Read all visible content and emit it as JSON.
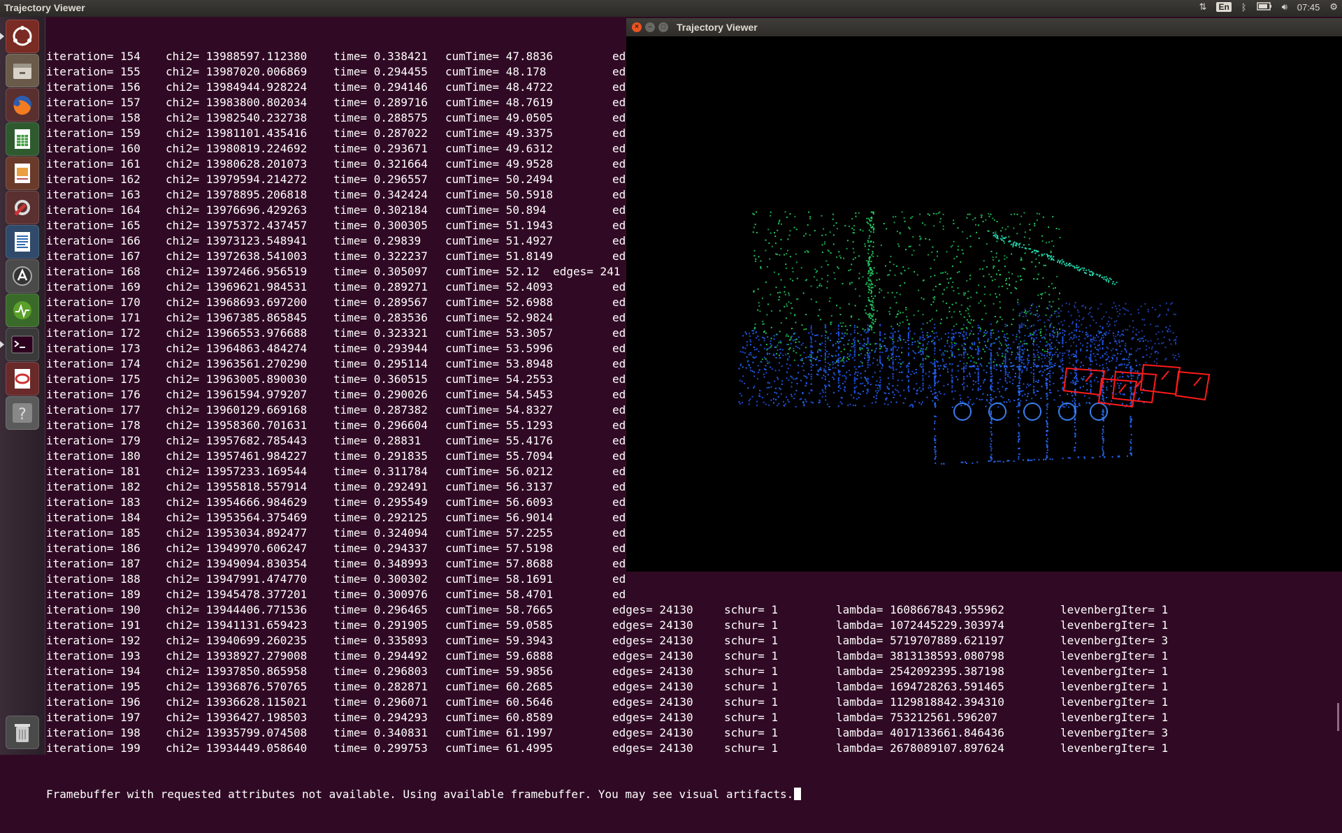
{
  "top_panel": {
    "title": "Trajectory Viewer",
    "keyboard": "En",
    "time": "07:45",
    "icons": [
      "network-arrows-icon",
      "keyboard-layout-icon",
      "bluetooth-icon",
      "battery-icon",
      "volume-icon",
      "gear-icon"
    ]
  },
  "launcher": {
    "items": [
      {
        "name": "ubuntu-dash-icon",
        "bg": "#7a2b23"
      },
      {
        "name": "files-icon",
        "bg": "#6a5a4a"
      },
      {
        "name": "firefox-icon",
        "bg": "#5a2f2f"
      },
      {
        "name": "spreadsheet-icon",
        "bg": "#2f5a2f"
      },
      {
        "name": "presentation-icon",
        "bg": "#6a3a2a"
      },
      {
        "name": "system-settings-icon",
        "bg": "#5a3030"
      },
      {
        "name": "writer-document-icon",
        "bg": "#2f4a6a"
      },
      {
        "name": "software-updater-icon",
        "bg": "#4a4a4a"
      },
      {
        "name": "system-monitor-icon",
        "bg": "#3a6a2a"
      },
      {
        "name": "terminal-icon",
        "bg": "#3a3a3a"
      },
      {
        "name": "document-viewer-icon",
        "bg": "#6a2a2a"
      },
      {
        "name": "unknown-app-icon",
        "bg": "#5a5a5a"
      }
    ],
    "trash": {
      "name": "trash-icon"
    }
  },
  "terminal": {
    "lines": [
      {
        "it": "iteration= 154",
        "chi": "chi2= 13988597.112380",
        "tm": "time= 0.338421",
        "cum": "cumTime= 47.8836",
        "ed": "ed"
      },
      {
        "it": "iteration= 155",
        "chi": "chi2= 13987020.006869",
        "tm": "time= 0.294455",
        "cum": "cumTime= 48.178",
        "ed": "ed"
      },
      {
        "it": "iteration= 156",
        "chi": "chi2= 13984944.928224",
        "tm": "time= 0.294146",
        "cum": "cumTime= 48.4722",
        "ed": "ed"
      },
      {
        "it": "iteration= 157",
        "chi": "chi2= 13983800.802034",
        "tm": "time= 0.289716",
        "cum": "cumTime= 48.7619",
        "ed": "ed"
      },
      {
        "it": "iteration= 158",
        "chi": "chi2= 13982540.232738",
        "tm": "time= 0.288575",
        "cum": "cumTime= 49.0505",
        "ed": "ed"
      },
      {
        "it": "iteration= 159",
        "chi": "chi2= 13981101.435416",
        "tm": "time= 0.287022",
        "cum": "cumTime= 49.3375",
        "ed": "ed"
      },
      {
        "it": "iteration= 160",
        "chi": "chi2= 13980819.224692",
        "tm": "time= 0.293671",
        "cum": "cumTime= 49.6312",
        "ed": "ed"
      },
      {
        "it": "iteration= 161",
        "chi": "chi2= 13980628.201073",
        "tm": "time= 0.321664",
        "cum": "cumTime= 49.9528",
        "ed": "ed"
      },
      {
        "it": "iteration= 162",
        "chi": "chi2= 13979594.214272",
        "tm": "time= 0.296557",
        "cum": "cumTime= 50.2494",
        "ed": "ed"
      },
      {
        "it": "iteration= 163",
        "chi": "chi2= 13978895.206818",
        "tm": "time= 0.342424",
        "cum": "cumTime= 50.5918",
        "ed": "ed"
      },
      {
        "it": "iteration= 164",
        "chi": "chi2= 13976696.429263",
        "tm": "time= 0.302184",
        "cum": "cumTime= 50.894",
        "ed": "ed"
      },
      {
        "it": "iteration= 165",
        "chi": "chi2= 13975372.437457",
        "tm": "time= 0.300305",
        "cum": "cumTime= 51.1943",
        "ed": "ed"
      },
      {
        "it": "iteration= 166",
        "chi": "chi2= 13973123.548941",
        "tm": "time= 0.29839",
        "cum": "cumTime= 51.4927",
        "ed": "ed"
      },
      {
        "it": "iteration= 167",
        "chi": "chi2= 13972638.541003",
        "tm": "time= 0.322237",
        "cum": "cumTime= 51.8149",
        "ed": "ed"
      },
      {
        "it": "iteration= 168",
        "chi": "chi2= 13972466.956519",
        "tm": "time= 0.305097",
        "cum": "cumTime= 52.12  edges= 241",
        "ed": ""
      },
      {
        "it": "iteration= 169",
        "chi": "chi2= 13969621.984531",
        "tm": "time= 0.289271",
        "cum": "cumTime= 52.4093",
        "ed": "ed"
      },
      {
        "it": "iteration= 170",
        "chi": "chi2= 13968693.697200",
        "tm": "time= 0.289567",
        "cum": "cumTime= 52.6988",
        "ed": "ed"
      },
      {
        "it": "iteration= 171",
        "chi": "chi2= 13967385.865845",
        "tm": "time= 0.283536",
        "cum": "cumTime= 52.9824",
        "ed": "ed"
      },
      {
        "it": "iteration= 172",
        "chi": "chi2= 13966553.976688",
        "tm": "time= 0.323321",
        "cum": "cumTime= 53.3057",
        "ed": "ed"
      },
      {
        "it": "iteration= 173",
        "chi": "chi2= 13964863.484274",
        "tm": "time= 0.293944",
        "cum": "cumTime= 53.5996",
        "ed": "ed"
      },
      {
        "it": "iteration= 174",
        "chi": "chi2= 13963561.270290",
        "tm": "time= 0.295114",
        "cum": "cumTime= 53.8948",
        "ed": "ed"
      },
      {
        "it": "iteration= 175",
        "chi": "chi2= 13963005.890030",
        "tm": "time= 0.360515",
        "cum": "cumTime= 54.2553",
        "ed": "ed"
      },
      {
        "it": "iteration= 176",
        "chi": "chi2= 13961594.979207",
        "tm": "time= 0.290026",
        "cum": "cumTime= 54.5453",
        "ed": "ed"
      },
      {
        "it": "iteration= 177",
        "chi": "chi2= 13960129.669168",
        "tm": "time= 0.287382",
        "cum": "cumTime= 54.8327",
        "ed": "ed"
      },
      {
        "it": "iteration= 178",
        "chi": "chi2= 13958360.701631",
        "tm": "time= 0.296604",
        "cum": "cumTime= 55.1293",
        "ed": "ed"
      },
      {
        "it": "iteration= 179",
        "chi": "chi2= 13957682.785443",
        "tm": "time= 0.28831",
        "cum": "cumTime= 55.4176",
        "ed": "ed"
      },
      {
        "it": "iteration= 180",
        "chi": "chi2= 13957461.984227",
        "tm": "time= 0.291835",
        "cum": "cumTime= 55.7094",
        "ed": "ed"
      },
      {
        "it": "iteration= 181",
        "chi": "chi2= 13957233.169544",
        "tm": "time= 0.311784",
        "cum": "cumTime= 56.0212",
        "ed": "ed"
      },
      {
        "it": "iteration= 182",
        "chi": "chi2= 13955818.557914",
        "tm": "time= 0.292491",
        "cum": "cumTime= 56.3137",
        "ed": "ed"
      },
      {
        "it": "iteration= 183",
        "chi": "chi2= 13954666.984629",
        "tm": "time= 0.295549",
        "cum": "cumTime= 56.6093",
        "ed": "ed"
      },
      {
        "it": "iteration= 184",
        "chi": "chi2= 13953564.375469",
        "tm": "time= 0.292125",
        "cum": "cumTime= 56.9014",
        "ed": "ed"
      },
      {
        "it": "iteration= 185",
        "chi": "chi2= 13953034.892477",
        "tm": "time= 0.324094",
        "cum": "cumTime= 57.2255",
        "ed": "ed"
      },
      {
        "it": "iteration= 186",
        "chi": "chi2= 13949970.606247",
        "tm": "time= 0.294337",
        "cum": "cumTime= 57.5198",
        "ed": "ed"
      },
      {
        "it": "iteration= 187",
        "chi": "chi2= 13949094.830354",
        "tm": "time= 0.348993",
        "cum": "cumTime= 57.8688",
        "ed": "ed"
      },
      {
        "it": "iteration= 188",
        "chi": "chi2= 13947991.474770",
        "tm": "time= 0.300302",
        "cum": "cumTime= 58.1691",
        "ed": "ed"
      },
      {
        "it": "iteration= 189",
        "chi": "chi2= 13945478.377201",
        "tm": "time= 0.300976",
        "cum": "cumTime= 58.4701",
        "ed": "ed"
      },
      {
        "it": "iteration= 190",
        "chi": "chi2= 13944406.771536",
        "tm": "time= 0.296465",
        "cum": "cumTime= 58.7665",
        "ed": "edges= 24130",
        "sch": "schur= 1",
        "lam": "lambda= 1608667843.955962",
        "lev": "levenbergIter= 1"
      },
      {
        "it": "iteration= 191",
        "chi": "chi2= 13941131.659423",
        "tm": "time= 0.291905",
        "cum": "cumTime= 59.0585",
        "ed": "edges= 24130",
        "sch": "schur= 1",
        "lam": "lambda= 1072445229.303974",
        "lev": "levenbergIter= 1"
      },
      {
        "it": "iteration= 192",
        "chi": "chi2= 13940699.260235",
        "tm": "time= 0.335893",
        "cum": "cumTime= 59.3943",
        "ed": "edges= 24130",
        "sch": "schur= 1",
        "lam": "lambda= 5719707889.621197",
        "lev": "levenbergIter= 3"
      },
      {
        "it": "iteration= 193",
        "chi": "chi2= 13938927.279008",
        "tm": "time= 0.294492",
        "cum": "cumTime= 59.6888",
        "ed": "edges= 24130",
        "sch": "schur= 1",
        "lam": "lambda= 3813138593.080798",
        "lev": "levenbergIter= 1"
      },
      {
        "it": "iteration= 194",
        "chi": "chi2= 13937850.865958",
        "tm": "time= 0.296803",
        "cum": "cumTime= 59.9856",
        "ed": "edges= 24130",
        "sch": "schur= 1",
        "lam": "lambda= 2542092395.387198",
        "lev": "levenbergIter= 1"
      },
      {
        "it": "iteration= 195",
        "chi": "chi2= 13936876.570765",
        "tm": "time= 0.282871",
        "cum": "cumTime= 60.2685",
        "ed": "edges= 24130",
        "sch": "schur= 1",
        "lam": "lambda= 1694728263.591465",
        "lev": "levenbergIter= 1"
      },
      {
        "it": "iteration= 196",
        "chi": "chi2= 13936628.115021",
        "tm": "time= 0.296071",
        "cum": "cumTime= 60.5646",
        "ed": "edges= 24130",
        "sch": "schur= 1",
        "lam": "lambda= 1129818842.394310",
        "lev": "levenbergIter= 1"
      },
      {
        "it": "iteration= 197",
        "chi": "chi2= 13936427.198503",
        "tm": "time= 0.294293",
        "cum": "cumTime= 60.8589",
        "ed": "edges= 24130",
        "sch": "schur= 1",
        "lam": "lambda= 753212561.596207",
        "lev": "levenbergIter= 1"
      },
      {
        "it": "iteration= 198",
        "chi": "chi2= 13935799.074508",
        "tm": "time= 0.340831",
        "cum": "cumTime= 61.1997",
        "ed": "edges= 24130",
        "sch": "schur= 1",
        "lam": "lambda= 4017133661.846436",
        "lev": "levenbergIter= 3"
      },
      {
        "it": "iteration= 199",
        "chi": "chi2= 13934449.058640",
        "tm": "time= 0.299753",
        "cum": "cumTime= 61.4995",
        "ed": "edges= 24130",
        "sch": "schur= 1",
        "lam": "lambda= 2678089107.897624",
        "lev": "levenbergIter= 1"
      }
    ],
    "final_message": "Framebuffer with requested attributes not available. Using available framebuffer. You may see visual artifacts."
  },
  "viewer": {
    "title": "Trajectory Viewer",
    "close_label": "×",
    "min_label": "–",
    "max_label": "□",
    "colors": {
      "green_points": "#22c55e",
      "blue_points": "#1d4ed8",
      "camera_frustums": "#ff1a1a",
      "background": "#000000"
    }
  }
}
